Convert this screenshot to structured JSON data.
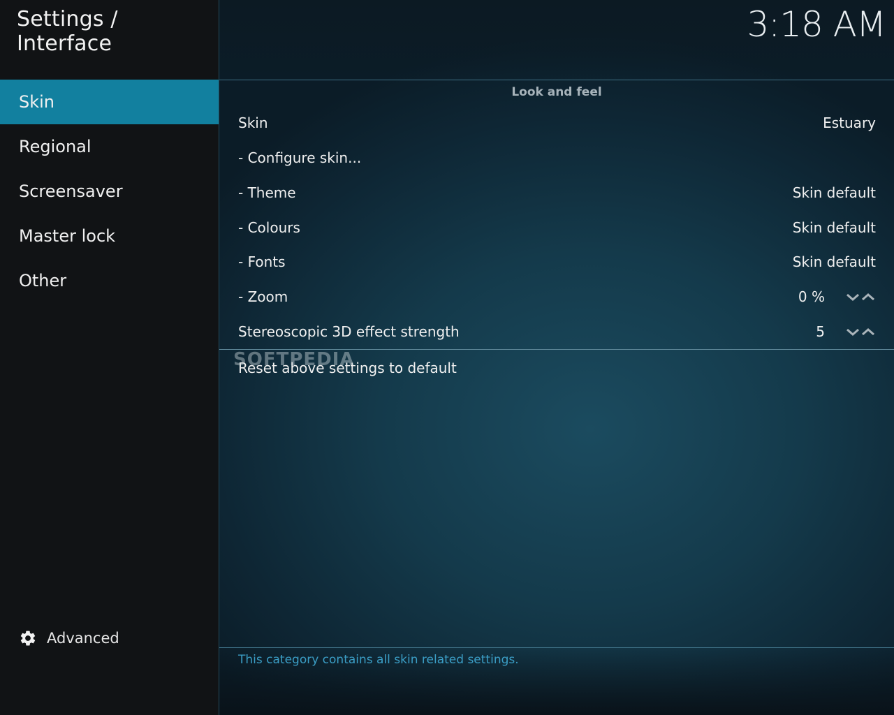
{
  "header": {
    "title": "Settings / Interface",
    "clock": "3:18 AM"
  },
  "sidebar": {
    "items": [
      {
        "label": "Skin",
        "active": true
      },
      {
        "label": "Regional",
        "active": false
      },
      {
        "label": "Screensaver",
        "active": false
      },
      {
        "label": "Master lock",
        "active": false
      },
      {
        "label": "Other",
        "active": false
      }
    ],
    "advanced": {
      "icon": "gear-icon",
      "label": "Advanced"
    }
  },
  "main": {
    "section_title": "Look and feel",
    "settings": [
      {
        "label": "Skin",
        "value": "Estuary"
      },
      {
        "label": "- Configure skin...",
        "value": ""
      },
      {
        "label": "- Theme",
        "value": "Skin default"
      },
      {
        "label": "- Colours",
        "value": "Skin default"
      },
      {
        "label": "- Fonts",
        "value": "Skin default"
      },
      {
        "label": "- Zoom",
        "value": "0 %"
      },
      {
        "label": "Stereoscopic 3D effect strength",
        "value": "5"
      }
    ],
    "reset_label": "Reset above settings to default",
    "description": "This category contains all skin related settings."
  },
  "watermark": "SOFTPEDIA",
  "colors": {
    "accent": "#12809f",
    "description_text": "#3b9ec6"
  }
}
